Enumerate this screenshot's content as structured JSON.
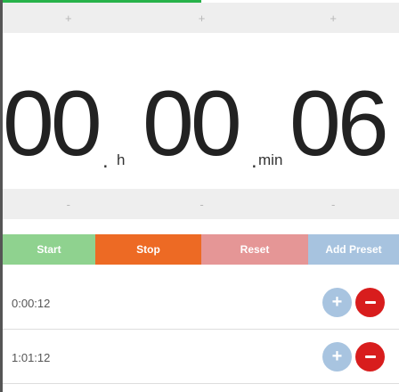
{
  "timer": {
    "hours": "00",
    "minutes": "00",
    "seconds": "06",
    "hours_unit": "h",
    "minutes_unit": "min",
    "progress": 0.5
  },
  "increment_row": {
    "plus": "+",
    "minus": "-"
  },
  "buttons": {
    "start": "Start",
    "stop": "Stop",
    "reset": "Reset",
    "add_preset": "Add Preset"
  },
  "presets": [
    {
      "time": "0:00:12"
    },
    {
      "time": "1:01:12"
    }
  ],
  "colors": {
    "progress": "#27b24a",
    "start": "#8fd28f",
    "stop": "#ed6a24",
    "reset": "#e59696",
    "add_preset": "#a7c3df",
    "delete": "#d81d1d",
    "add": "#a8c4e0"
  }
}
